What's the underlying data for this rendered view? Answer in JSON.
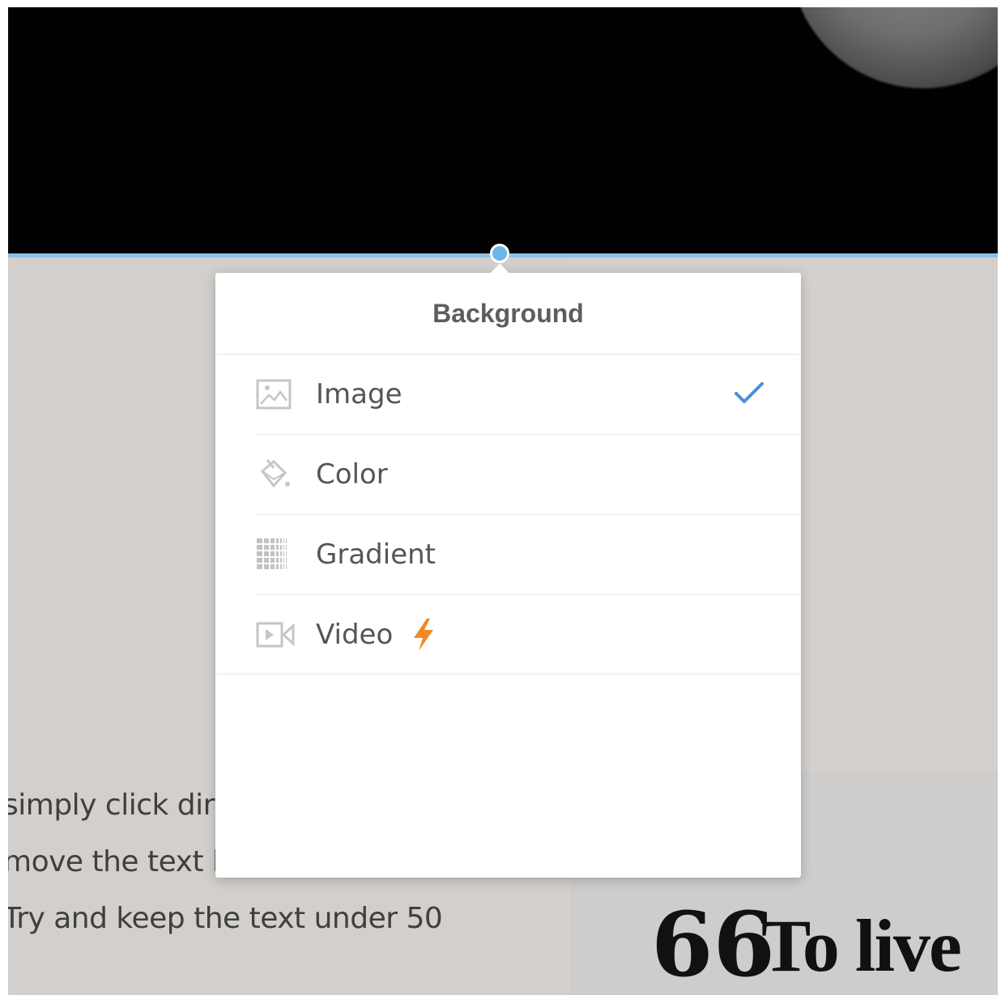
{
  "background_menu": {
    "title": "Background",
    "options": [
      {
        "label": "Image",
        "icon": "image-icon",
        "selected": true
      },
      {
        "label": "Color",
        "icon": "paint-bucket-icon",
        "selected": false
      },
      {
        "label": "Gradient",
        "icon": "gradient-icon",
        "selected": false
      },
      {
        "label": "Video",
        "icon": "video-icon",
        "selected": false,
        "badge": "lightning-bolt-icon"
      }
    ]
  },
  "page_text": {
    "line1": "simply click dir",
    "line2": "move the text b",
    "line3": "Try and keep the text under 50",
    "quote_mark": "66",
    "quote": "To live"
  },
  "colors": {
    "accent": "#4a90d9",
    "divider": "#8ec0e6",
    "badge": "#f08a24"
  }
}
